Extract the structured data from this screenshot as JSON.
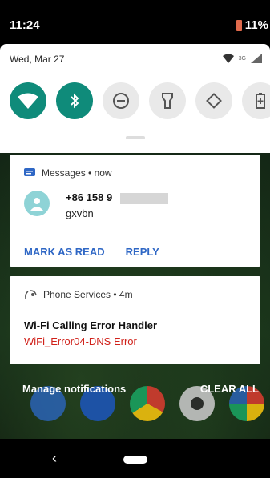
{
  "status_bar": {
    "time": "11:24",
    "battery": "11%"
  },
  "quick_settings": {
    "date": "Wed, Mar 27",
    "network_label": "3G",
    "tiles": [
      {
        "name": "wifi",
        "state": "on"
      },
      {
        "name": "bluetooth",
        "state": "on"
      },
      {
        "name": "do-not-disturb",
        "state": "off"
      },
      {
        "name": "flashlight",
        "state": "off"
      },
      {
        "name": "auto-rotate",
        "state": "off"
      },
      {
        "name": "battery-saver",
        "state": "off"
      }
    ]
  },
  "notifications": {
    "messages": {
      "app": "Messages • now",
      "sender": "+86 158 9",
      "text": "gxvbn",
      "actions": [
        "MARK AS READ",
        "REPLY"
      ]
    },
    "phone_services": {
      "app": "Phone Services • 4m",
      "title": "Wi-Fi Calling Error Handler",
      "error": "WiFi_Error04-DNS Error"
    }
  },
  "bottom_bar": {
    "manage": "Manage notifications",
    "clear": "CLEAR ALL"
  },
  "colors": {
    "accent": "#0f8b7a",
    "action": "#2f67c5",
    "error": "#d0211a"
  }
}
